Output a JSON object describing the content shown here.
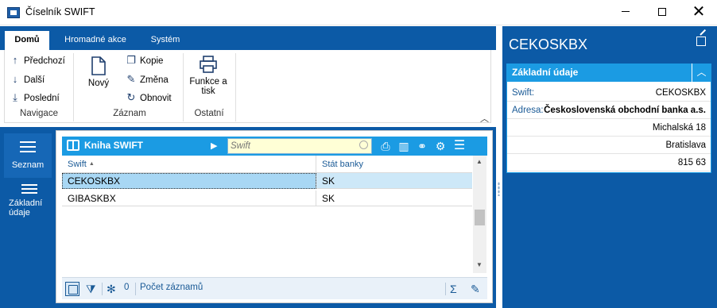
{
  "window": {
    "title": "Číselník SWIFT",
    "min_label": "",
    "max_label": "",
    "close_label": "✕"
  },
  "ribbon": {
    "tabs": [
      {
        "label": "Domů",
        "active": true
      },
      {
        "label": "Hromadné akce",
        "active": false
      },
      {
        "label": "Systém",
        "active": false
      }
    ],
    "groups": {
      "navigace": {
        "label": "Navigace",
        "items": [
          {
            "label": "Předchozí",
            "icon": "arrow-up-icon"
          },
          {
            "label": "Další",
            "icon": "arrow-down-icon"
          },
          {
            "label": "Poslední",
            "icon": "arrow-down-to-line-icon"
          }
        ]
      },
      "zaznam": {
        "label": "Záznam",
        "new_label": "Nový",
        "items": [
          {
            "label": "Kopie",
            "icon": "copy-icon"
          },
          {
            "label": "Změna",
            "icon": "pencil-icon"
          },
          {
            "label": "Obnovit",
            "icon": "refresh-icon"
          }
        ]
      },
      "ostatni": {
        "label": "Ostatní",
        "print_label_1": "Funkce a",
        "print_label_2": "tisk"
      }
    }
  },
  "leftnav": {
    "items": [
      {
        "label": "Seznam",
        "active": true
      },
      {
        "label_1": "Základní",
        "label_2": "údaje",
        "active": false
      }
    ]
  },
  "grid": {
    "title": "Kniha SWIFT",
    "search_placeholder": "Swift",
    "columns": [
      "Swift",
      "Stát banky"
    ],
    "rows": [
      {
        "swift": "CEKOSKBX",
        "stat": "SK",
        "selected": true
      },
      {
        "swift": "GIBASKBX",
        "stat": "SK",
        "selected": false
      }
    ],
    "footer": {
      "count": "0",
      "count_label": "Počet záznamů"
    }
  },
  "detail": {
    "title": "CEKOSKBX",
    "section_title": "Základní údaje",
    "swift_label": "Swift:",
    "swift_value": "CEKOSKBX",
    "adresa_label": "Adresa:",
    "adresa_lines": [
      "Československá obchodní banka a.s.",
      "Michalská 18",
      "Bratislava",
      "815 63"
    ]
  },
  "colors": {
    "brand_blue": "#0c5aa6",
    "accent_blue": "#1b9be3",
    "selection": "#cde8f8"
  }
}
